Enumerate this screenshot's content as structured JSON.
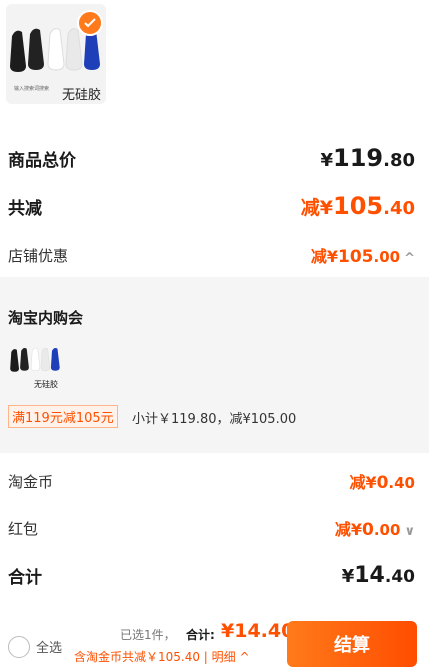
{
  "product": {
    "thumb_caption": "无硅胶",
    "thumb_sub": "输入搜索词搜索"
  },
  "summary": {
    "total_label": "商品总价",
    "total_yen": "¥",
    "total_int": "119",
    "total_dec": ".80",
    "discount_label": "共减",
    "discount_prefix": "减¥",
    "discount_int": "105",
    "discount_dec": ".40",
    "store_label": "店铺优惠",
    "store_prefix": "减¥",
    "store_int": "105",
    "store_dec": ".00"
  },
  "store_panel": {
    "title": "淘宝内购会",
    "thumb_caption": "无硅胶",
    "promo_tag": "满119元减105元",
    "promo_summary": "小计￥119.80，减¥105.00"
  },
  "extras": {
    "coin_label": "淘金币",
    "coin_prefix": "减¥",
    "coin_int": "0",
    "coin_dec": ".40",
    "redpack_label": "红包",
    "redpack_prefix": "减¥",
    "redpack_int": "0",
    "redpack_dec": ".00",
    "total_label": "合计",
    "total_yen": "¥",
    "total_int": "14",
    "total_dec": ".40"
  },
  "footer": {
    "select_all": "全选",
    "selected_count": "已选1件，",
    "total_label": "合计:",
    "total_value": "¥14.40",
    "discount_line": "含淘金币共减￥105.40 | 明细 ^",
    "checkout": "结算"
  },
  "colors": {
    "accent": "#ff5000",
    "accent_light": "#ff7a1a"
  }
}
